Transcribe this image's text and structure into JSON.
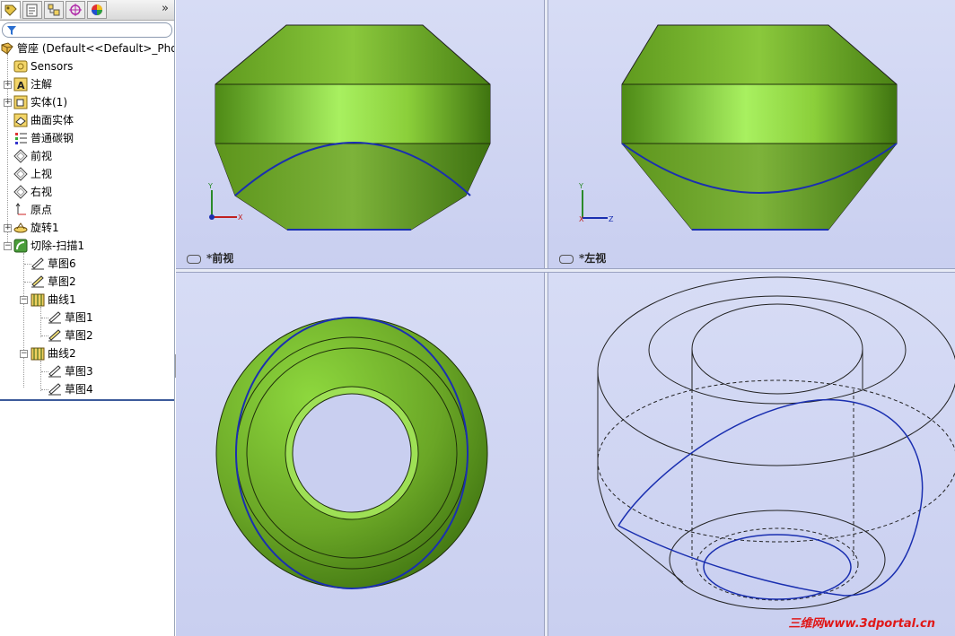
{
  "panel": {
    "tabs": [
      "feature-manager-tab",
      "property-manager-tab",
      "configuration-manager-tab",
      "dimxpert-tab",
      "display-manager-tab"
    ],
    "more_symbol": "»"
  },
  "tree": {
    "root": "管座  (Default<<Default>_Phot",
    "items": [
      {
        "label": "Sensors",
        "icon": "sensors-icon"
      },
      {
        "label": "注解",
        "icon": "annotations-icon"
      },
      {
        "label": "实体(1)",
        "icon": "solid-bodies-icon"
      },
      {
        "label": "曲面实体",
        "icon": "surface-bodies-icon"
      },
      {
        "label": "普通碳钢",
        "icon": "material-icon"
      },
      {
        "label": "前视",
        "icon": "plane-icon"
      },
      {
        "label": "上视",
        "icon": "plane-icon"
      },
      {
        "label": "右视",
        "icon": "plane-icon"
      },
      {
        "label": "原点",
        "icon": "origin-icon"
      },
      {
        "label": "旋转1",
        "icon": "revolve-icon"
      },
      {
        "label": "切除-扫描1",
        "icon": "sweep-cut-icon"
      },
      {
        "label": "草图6",
        "icon": "sketch-icon"
      },
      {
        "label": "草图2",
        "icon": "sketch-icon"
      },
      {
        "label": "曲线1",
        "icon": "curve-icon"
      },
      {
        "label": "草图1",
        "icon": "sketch-icon"
      },
      {
        "label": "草图2",
        "icon": "sketch-icon"
      },
      {
        "label": "曲线2",
        "icon": "curve-icon"
      },
      {
        "label": "草图3",
        "icon": "sketch-icon"
      },
      {
        "label": "草图4",
        "icon": "sketch-icon"
      }
    ]
  },
  "viewports": {
    "front_label": "*前视",
    "left_label": "*左视",
    "triad_front": {
      "y": "Y",
      "x": "X"
    },
    "triad_left": {
      "y": "Y",
      "x": "X",
      "z": "Z"
    }
  },
  "colors": {
    "part_green": "#7fb62e",
    "edge_blue": "#1a2fb0",
    "viewport_bg": "#cdd3f2"
  },
  "watermark": "三维网www.3dportal.cn"
}
